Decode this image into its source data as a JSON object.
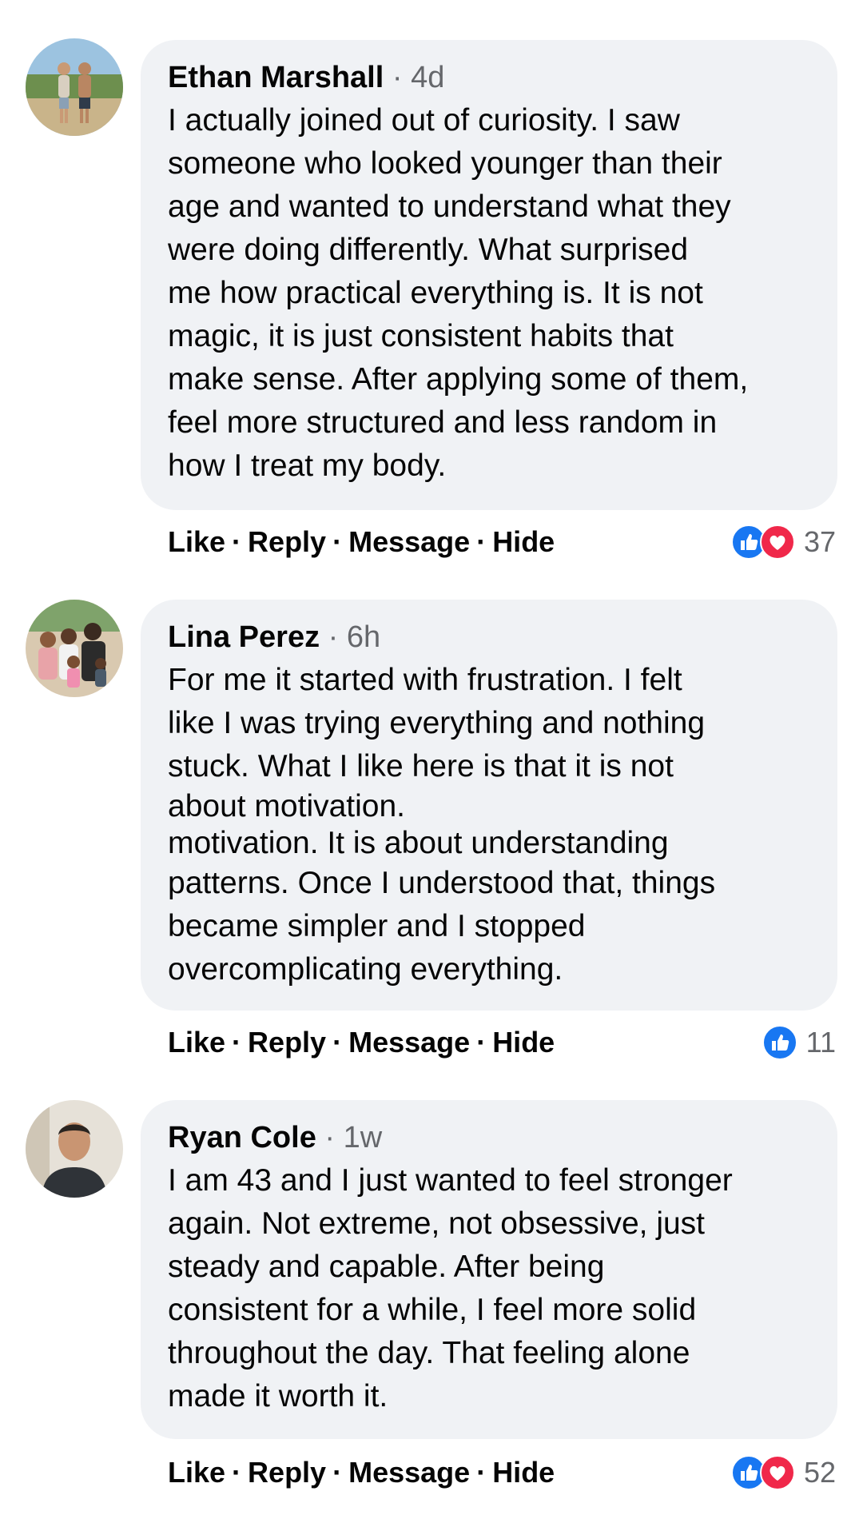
{
  "comments": [
    {
      "author": "Ethan Marshall",
      "time": "4d",
      "lines": [
        "I actually joined out of curiosity. I saw",
        "someone who looked younger than their",
        "age and wanted to understand what they",
        "were doing differently. What surprised",
        "me how practical everything is. It is not",
        "magic, it is just consistent habits that",
        "make sense. After applying some of them,",
        "feel more structured and less random in",
        "how I treat my body."
      ],
      "actions": [
        "Like",
        "Reply",
        "Message",
        "Hide"
      ],
      "reaction_count": "37",
      "reactions": [
        "like-icon",
        "love-icon"
      ]
    },
    {
      "author": "Lina Perez",
      "time": "6h",
      "lines": [
        "For me it started with frustration. I felt",
        "like I was trying everything and nothing",
        "stuck. What I like here is that it is not",
        "about motivation.",
        "motivation. It is about understanding",
        "patterns. Once I understood that, things",
        "became simpler and I stopped",
        "overcomplicating everything."
      ],
      "actions": [
        "Like",
        "Reply",
        "Message",
        "Hide"
      ],
      "reaction_count": "11",
      "reactions": [
        "like-icon"
      ]
    },
    {
      "author": "Ryan Cole",
      "time": "1w",
      "lines": [
        "I am 43 and I just wanted to feel stronger",
        "again. Not extreme, not obsessive, just",
        "steady and capable. After being",
        "consistent for a while, I feel more solid",
        "throughout the day. That feeling alone",
        "made it worth it."
      ],
      "actions": [
        "Like",
        "Reply",
        "Message",
        "Hide"
      ],
      "reaction_count": "52",
      "reactions": [
        "like-icon",
        "love-icon"
      ]
    }
  ],
  "separator": "·",
  "colors": {
    "bubble": "#f0f2f5",
    "meta_gray": "#65676b",
    "like_blue": "#1877f2",
    "love_red": "#f0284a"
  }
}
